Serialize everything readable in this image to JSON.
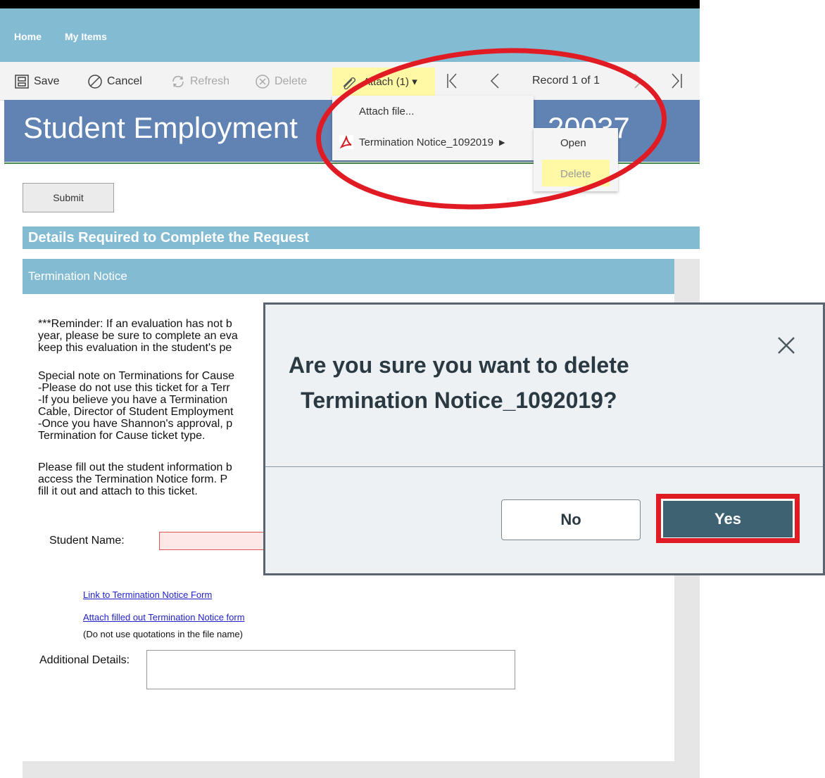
{
  "nav": {
    "home": "Home",
    "my_items": "My Items"
  },
  "toolbar": {
    "save": "Save",
    "cancel": "Cancel",
    "refresh": "Refresh",
    "delete": "Delete",
    "attach": "Attach (1) ▾",
    "record": "Record 1 of 1"
  },
  "header": {
    "title": "Student Employment",
    "number": "20037"
  },
  "attach_menu": {
    "attach_file": "Attach file...",
    "file_name": "Termination Notice_1092019",
    "open": "Open",
    "delete": "Delete"
  },
  "submit": "Submit",
  "section_title": "Details Required to Complete the Request",
  "sub_section": "Termination Notice",
  "reminder": "***Reminder: If an evaluation has not b\nyear, please be sure to complete an eva\nkeep this evaluation in the student's pe",
  "special_note": "Special note on Terminations for Cause\n-Please do not use this ticket for a Terr\n-If you believe you have a Termination\nCable, Director of Student Employment\n-Once you have Shannon's approval, p\nTermination for Cause ticket type.",
  "fill_out": "Please fill out the student information b\naccess the Termination Notice form. P\nfill it out and attach to this ticket.",
  "student_name_label": "Student Name:",
  "link_form": "Link to Termination Notice Form",
  "link_attach": "Attach filled out Termination Notice form",
  "no_quotes_note": "(Do not use quotations in the file name)",
  "additional_details_label": "Additional Details:",
  "dialog": {
    "title": "Are you sure you want to delete\nTermination Notice_1092019?",
    "no": "No",
    "yes": "Yes"
  },
  "colors": {
    "nav": "#83bbd3",
    "header": "#6083b4",
    "highlight": "#fff9a6",
    "annotation_red": "#e11b24",
    "yes_button": "#3f6272"
  },
  "icons": [
    "save-icon",
    "cancel-icon",
    "refresh-icon",
    "delete-icon",
    "paperclip-icon",
    "first-record-icon",
    "prev-record-icon",
    "next-record-icon",
    "last-record-icon",
    "pdf-icon",
    "submenu-arrow-icon",
    "close-icon"
  ]
}
